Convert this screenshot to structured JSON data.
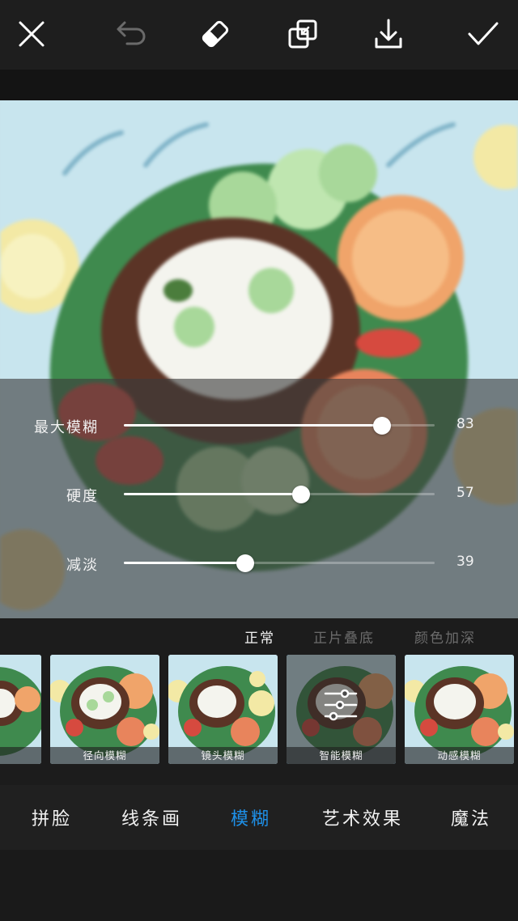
{
  "toolbar": {
    "close_icon": "close-icon",
    "undo_icon": "undo-icon",
    "eraser_icon": "eraser-icon",
    "compare_icon": "compare-icon",
    "download_icon": "download-icon",
    "confirm_icon": "checkmark-icon"
  },
  "sliders": [
    {
      "label": "最大模糊",
      "value": "83",
      "level": 83
    },
    {
      "label": "硬度",
      "value": "57",
      "level": 57
    },
    {
      "label": "减淡",
      "value": "39",
      "level": 39
    }
  ],
  "blend_modes": {
    "items": [
      "正常",
      "正片叠底",
      "颜色加深"
    ],
    "selected": "正常"
  },
  "effects": [
    {
      "label": ""
    },
    {
      "label": "径向模糊"
    },
    {
      "label": "镜头模糊"
    },
    {
      "label": "智能模糊",
      "selected": true
    },
    {
      "label": "动感模糊"
    }
  ],
  "tabs": {
    "items": [
      "拼脸",
      "线条画",
      "模糊",
      "艺术效果",
      "魔法"
    ],
    "active": "模糊"
  },
  "colors": {
    "accent": "#1e90e8",
    "background": "#1c1c1c",
    "slider_fill": "#ffffff"
  }
}
